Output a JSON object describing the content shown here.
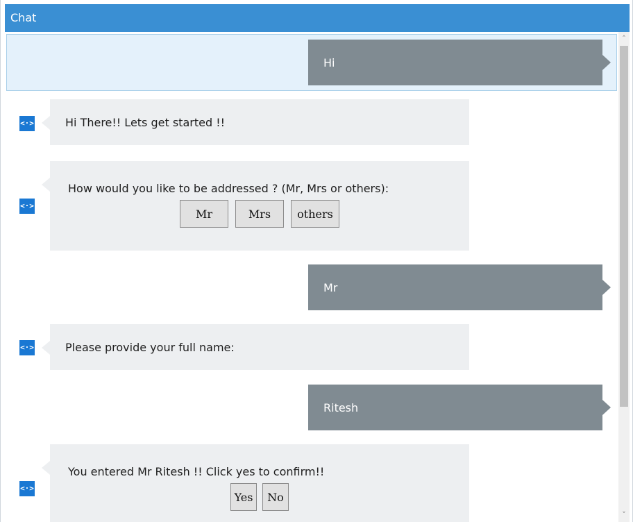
{
  "header": {
    "title": "Chat"
  },
  "messages": [
    {
      "from": "user",
      "text": "Hi"
    },
    {
      "from": "bot",
      "text": "Hi There!! Lets get started !!"
    },
    {
      "from": "bot",
      "text": "How would you like to be addressed ? (Mr, Mrs or others):",
      "buttons": [
        "Mr",
        "Mrs",
        "others"
      ]
    },
    {
      "from": "user",
      "text": "Mr"
    },
    {
      "from": "bot",
      "text": "Please provide your full name:"
    },
    {
      "from": "user",
      "text": "Ritesh"
    },
    {
      "from": "bot",
      "text": "You entered Mr Ritesh !! Click yes to confirm!!",
      "buttons": [
        "Yes",
        "No"
      ]
    }
  ],
  "icons": {
    "bot": "code-brackets-icon",
    "scroll_up": "chevron-up-icon",
    "scroll_down": "chevron-down-icon"
  },
  "colors": {
    "header": "#3a8fd3",
    "user_bubble": "#808b92",
    "bot_bubble": "#edeff1",
    "bot_icon": "#1a78d3",
    "selected_row": "#e4f1fb"
  }
}
